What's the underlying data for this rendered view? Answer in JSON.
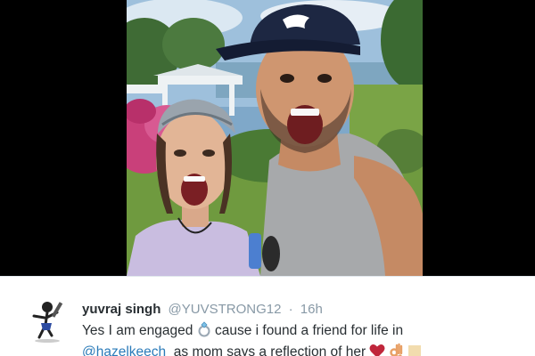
{
  "photo": {
    "description_icon": "selfie-photo",
    "cap_brand": "puma-logo-icon"
  },
  "tweet": {
    "display_name": "yuvraj singh",
    "handle": "@YUVSTRONG12",
    "separator": "·",
    "timestamp": "16h",
    "text_part1": "Yes I am engaged",
    "text_part2": "cause i found a friend for life in",
    "mention": "@hazelkeech",
    "text_part3": "as mom says a reflection of her",
    "emojis": [
      "ring-emoji",
      "red-heart-emoji",
      "ok-hand-emoji",
      "skin-tone-modifier"
    ],
    "colors": {
      "name": "#292f33",
      "meta": "#8899a6",
      "mention": "#2b7bb9",
      "heart": "#c0263b"
    }
  }
}
